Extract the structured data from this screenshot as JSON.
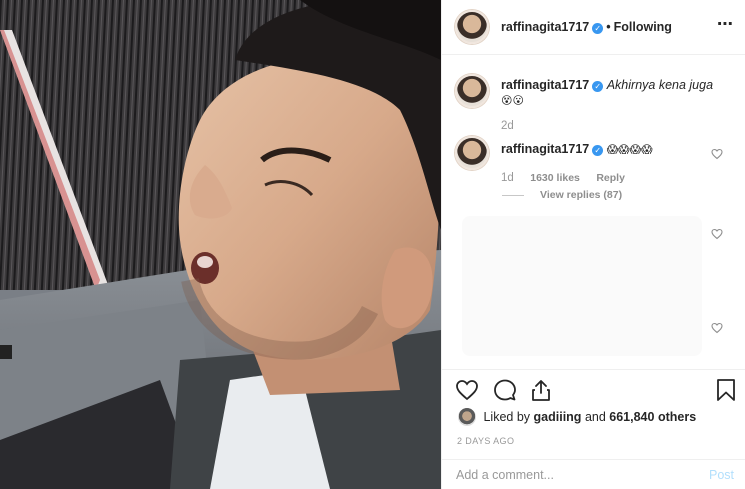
{
  "photo": {
    "icon": "post-photo-sleeping-man"
  },
  "header": {
    "username": "raffinagita1717",
    "verified_icon": "verified-badge-icon",
    "separator": "•",
    "follow_status": "Following",
    "more_icon": "⋯"
  },
  "caption": {
    "username": "raffinagita1717",
    "text": "Akhirnya kena juga",
    "emojis": "😵😮",
    "age": "2d"
  },
  "comment": {
    "username": "raffinagita1717",
    "emojis": "😱😱😱😱",
    "age": "1d",
    "likes": "1630 likes",
    "reply": "Reply",
    "view_replies": "View replies (87)"
  },
  "actions": {
    "like_icon": "heart-outline-icon",
    "comment_icon": "comment-bubble-icon",
    "share_icon": "share-icon",
    "save_icon": "bookmark-icon",
    "liked_by_prefix": "Liked by",
    "liked_by_user": "gadiiing",
    "liked_by_and": "and",
    "liked_by_count": "661,840 others",
    "timestamp": "2 DAYS AGO"
  },
  "add_comment": {
    "placeholder": "Add a comment...",
    "post_label": "Post"
  },
  "colors": {
    "link_blue": "#3897f0",
    "post_disabled": "#b2dffc",
    "muted": "#999999"
  }
}
